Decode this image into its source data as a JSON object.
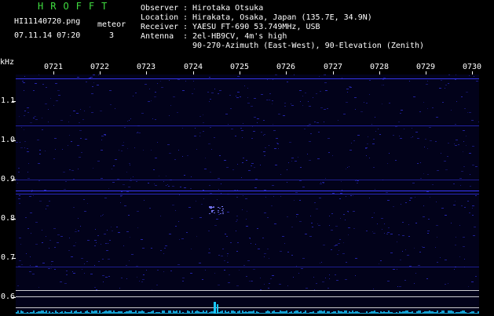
{
  "header": {
    "logo": "HROFFT",
    "filename": "HI11140720.png",
    "datetime": "07.11.14 07:20",
    "count_label": "meteor",
    "count_value": "3",
    "info": [
      {
        "label": "Observer",
        "value": "Hirotaka Otsuka"
      },
      {
        "label": "Location",
        "value": "Hirakata, Osaka, Japan (135.7E, 34.9N)"
      },
      {
        "label": "Receiver",
        "value": "YAESU FT-690 53.749MHz, USB"
      },
      {
        "label": "Antenna",
        "value": "2el-HB9CV, 4m's high"
      }
    ],
    "antenna_line2": "90-270-Azimuth (East-West), 90-Elevation (Zenith)"
  },
  "spectrogram": {
    "y_unit": "kHz",
    "y_ticks": [
      "1.1",
      "1.0",
      "0.9",
      "0.8",
      "0.7",
      "0.6"
    ],
    "x_ticks": [
      "0721",
      "0722",
      "0723",
      "0724",
      "0725",
      "0726",
      "0727",
      "0728",
      "0729",
      "0730"
    ],
    "colors": {
      "background": "#02021a",
      "signal": "#3a3aff",
      "noise": "#19c8ff",
      "grid": "#ffffff"
    }
  }
}
